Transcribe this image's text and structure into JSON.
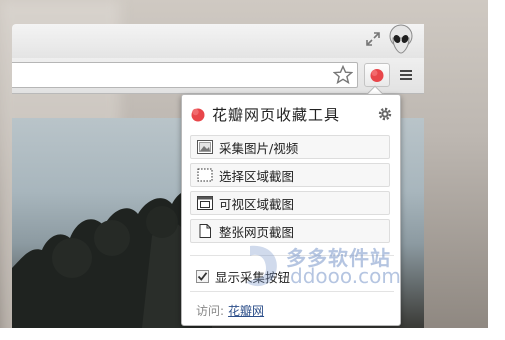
{
  "popup": {
    "title": "花瓣网页收藏工具",
    "actions": [
      {
        "label": "采集图片/视频"
      },
      {
        "label": "选择区域截图"
      },
      {
        "label": "可视区域截图"
      },
      {
        "label": "整张网页截图"
      }
    ],
    "show_button": {
      "label": "显示采集按钮",
      "checked": true
    },
    "visit_label": "访问:",
    "visit_link": "花瓣网"
  },
  "watermark": {
    "cn": "多多软件站",
    "en": "ddooo.com"
  },
  "colors": {
    "brand": "#e8464a",
    "popup_bg": "#ffffff",
    "link": "#2d4f8a"
  },
  "icons": [
    "fullscreen-icon",
    "alien-avatar-icon",
    "star-icon",
    "huaban-extension-icon",
    "menu-icon",
    "gear-icon",
    "image-icon",
    "region-select-icon",
    "visible-area-icon",
    "page-icon",
    "checkmark-icon"
  ]
}
